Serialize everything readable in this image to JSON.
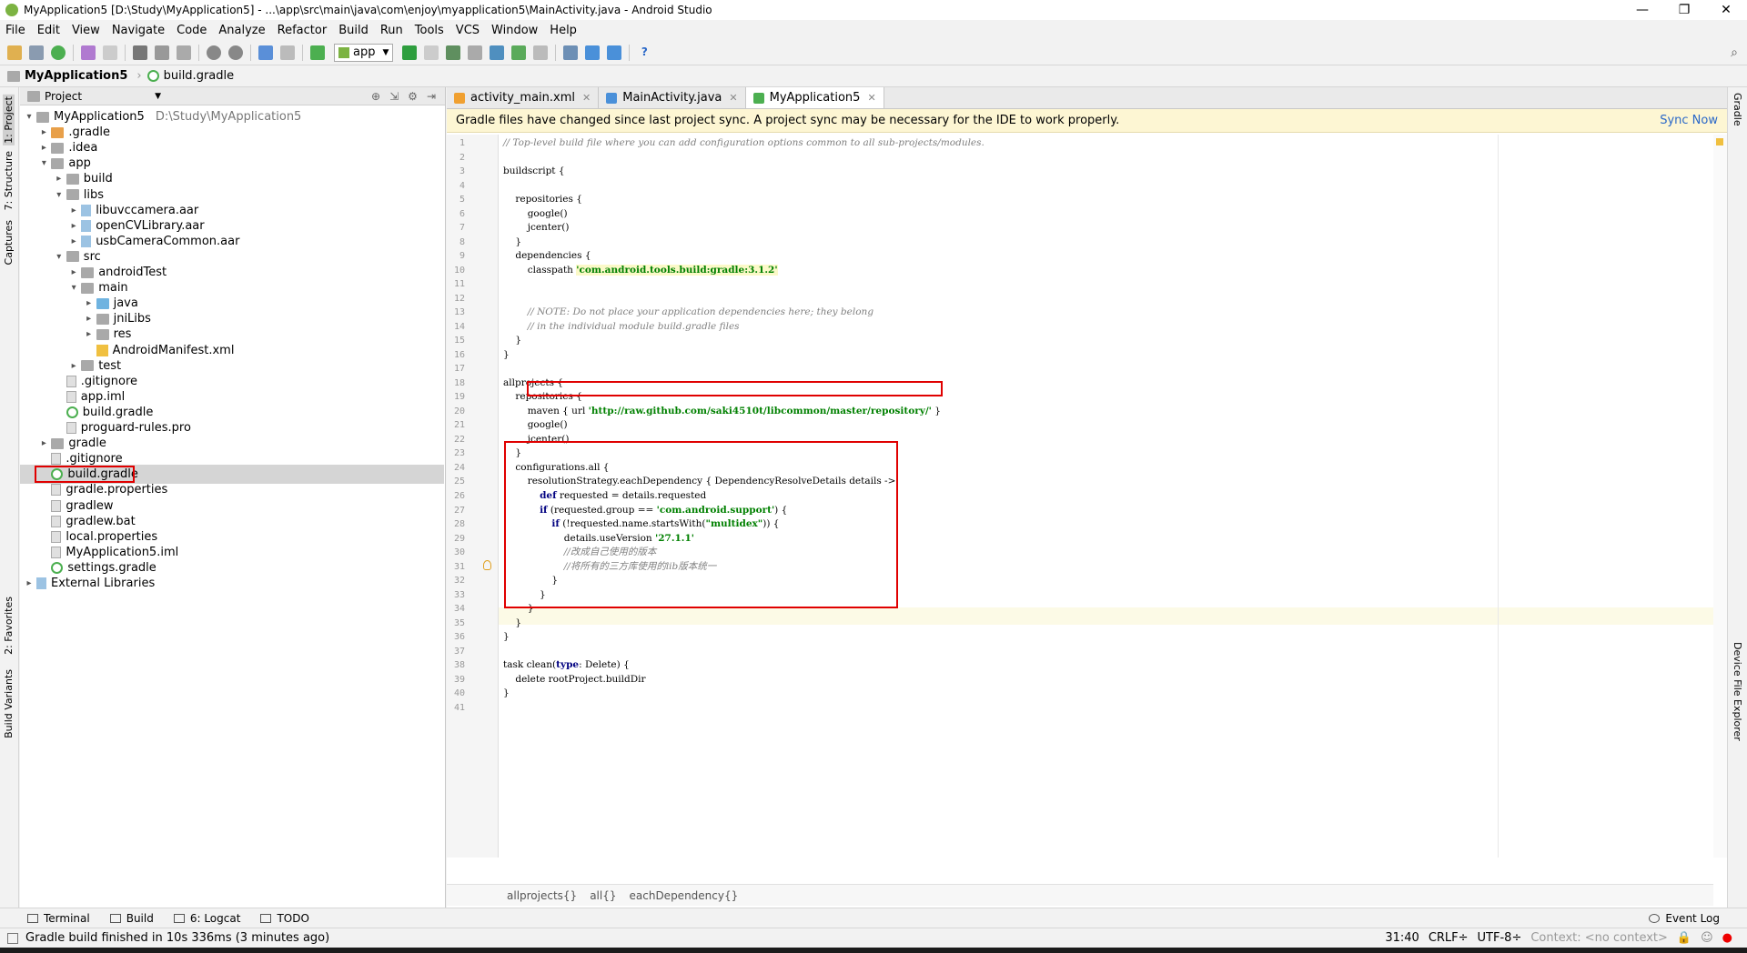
{
  "window": {
    "title": "MyApplication5 [D:\\Study\\MyApplication5] - ...\\app\\src\\main\\java\\com\\enjoy\\myapplication5\\MainActivity.java - Android Studio",
    "minimize": "—",
    "maximize": "❐",
    "close": "✕"
  },
  "menu": [
    "File",
    "Edit",
    "View",
    "Navigate",
    "Code",
    "Analyze",
    "Refactor",
    "Build",
    "Run",
    "Tools",
    "VCS",
    "Window",
    "Help"
  ],
  "toolbar": {
    "run_config": "app"
  },
  "navbar": {
    "project": "MyApplication5",
    "file": "build.gradle"
  },
  "left_strip": {
    "project": "1: Project",
    "structure": "7: Structure",
    "captures": "Captures",
    "favorites": "2: Favorites",
    "build_variants": "Build Variants"
  },
  "right_strip": {
    "gradle": "Gradle",
    "device_explorer": "Device File Explorer"
  },
  "project_panel": {
    "header": "Project",
    "tree": [
      {
        "label": "MyApplication5",
        "path": "D:\\Study\\MyApplication5",
        "depth": 0,
        "arrow": "▾",
        "icon": "folder"
      },
      {
        "label": ".gradle",
        "depth": 1,
        "arrow": "▸",
        "icon": "folder-orange"
      },
      {
        "label": ".idea",
        "depth": 1,
        "arrow": "▸",
        "icon": "folder"
      },
      {
        "label": "app",
        "depth": 1,
        "arrow": "▾",
        "icon": "folder"
      },
      {
        "label": "build",
        "depth": 2,
        "arrow": "▸",
        "icon": "folder"
      },
      {
        "label": "libs",
        "depth": 2,
        "arrow": "▾",
        "icon": "folder"
      },
      {
        "label": "libuvccamera.aar",
        "depth": 3,
        "arrow": "▸",
        "icon": "lib"
      },
      {
        "label": "openCVLibrary.aar",
        "depth": 3,
        "arrow": "▸",
        "icon": "lib"
      },
      {
        "label": "usbCameraCommon.aar",
        "depth": 3,
        "arrow": "▸",
        "icon": "lib"
      },
      {
        "label": "src",
        "depth": 2,
        "arrow": "▾",
        "icon": "folder"
      },
      {
        "label": "androidTest",
        "depth": 3,
        "arrow": "▸",
        "icon": "folder"
      },
      {
        "label": "main",
        "depth": 3,
        "arrow": "▾",
        "icon": "folder"
      },
      {
        "label": "java",
        "depth": 4,
        "arrow": "▸",
        "icon": "folder-blue"
      },
      {
        "label": "jniLibs",
        "depth": 4,
        "arrow": "▸",
        "icon": "folder"
      },
      {
        "label": "res",
        "depth": 4,
        "arrow": "▸",
        "icon": "folder"
      },
      {
        "label": "AndroidManifest.xml",
        "depth": 4,
        "arrow": "",
        "icon": "xml"
      },
      {
        "label": "test",
        "depth": 3,
        "arrow": "▸",
        "icon": "folder"
      },
      {
        "label": ".gitignore",
        "depth": 2,
        "arrow": "",
        "icon": "file"
      },
      {
        "label": "app.iml",
        "depth": 2,
        "arrow": "",
        "icon": "file"
      },
      {
        "label": "build.gradle",
        "depth": 2,
        "arrow": "",
        "icon": "gradle"
      },
      {
        "label": "proguard-rules.pro",
        "depth": 2,
        "arrow": "",
        "icon": "file"
      },
      {
        "label": "gradle",
        "depth": 1,
        "arrow": "▸",
        "icon": "folder"
      },
      {
        "label": ".gitignore",
        "depth": 1,
        "arrow": "",
        "icon": "file"
      },
      {
        "label": "build.gradle",
        "depth": 1,
        "arrow": "",
        "icon": "gradle",
        "selected": true
      },
      {
        "label": "gradle.properties",
        "depth": 1,
        "arrow": "",
        "icon": "file"
      },
      {
        "label": "gradlew",
        "depth": 1,
        "arrow": "",
        "icon": "file"
      },
      {
        "label": "gradlew.bat",
        "depth": 1,
        "arrow": "",
        "icon": "file"
      },
      {
        "label": "local.properties",
        "depth": 1,
        "arrow": "",
        "icon": "file"
      },
      {
        "label": "MyApplication5.iml",
        "depth": 1,
        "arrow": "",
        "icon": "file"
      },
      {
        "label": "settings.gradle",
        "depth": 1,
        "arrow": "",
        "icon": "gradle"
      },
      {
        "label": "External Libraries",
        "depth": 0,
        "arrow": "▸",
        "icon": "lib"
      }
    ]
  },
  "tabs": [
    {
      "label": "activity_main.xml",
      "color": "#f0a030",
      "active": false
    },
    {
      "label": "MainActivity.java",
      "color": "#4a90d9",
      "active": false
    },
    {
      "label": "MyApplication5",
      "color": "#4caf50",
      "active": true
    }
  ],
  "banner": {
    "message": "Gradle files have changed since last project sync. A project sync may be necessary for the IDE to work properly.",
    "action": "Sync Now"
  },
  "code_lines": [
    [
      {
        "t": "// Top-level build file where you can add configuration options common to all sub-projects/modules.",
        "c": "cm"
      }
    ],
    [],
    [
      {
        "t": "buildscript {"
      }
    ],
    [],
    [
      {
        "t": "    repositories {"
      }
    ],
    [
      {
        "t": "        google()"
      }
    ],
    [
      {
        "t": "        jcenter()"
      }
    ],
    [
      {
        "t": "    }"
      }
    ],
    [
      {
        "t": "    dependencies {"
      }
    ],
    [
      {
        "t": "        classpath "
      },
      {
        "t": "'com.android.tools.build:gradle:3.1.2'",
        "c": "st hl"
      }
    ],
    [],
    [],
    [
      {
        "t": "        // NOTE: Do not place your application dependencies here; they belong",
        "c": "cm"
      }
    ],
    [
      {
        "t": "        // in the individual module build.gradle files",
        "c": "cm"
      }
    ],
    [
      {
        "t": "    }"
      }
    ],
    [
      {
        "t": "}"
      }
    ],
    [],
    [
      {
        "t": "allprojects {"
      }
    ],
    [
      {
        "t": "    repositories {"
      }
    ],
    [
      {
        "t": "        maven { url "
      },
      {
        "t": "'http://raw.github.com/saki4510t/libcommon/master/repository/'",
        "c": "st"
      },
      {
        "t": " }"
      }
    ],
    [
      {
        "t": "        google()"
      }
    ],
    [
      {
        "t": "        jcenter()"
      }
    ],
    [
      {
        "t": "    }"
      }
    ],
    [
      {
        "t": "    configurations.all {"
      }
    ],
    [
      {
        "t": "        resolutionStrategy.eachDependency { DependencyResolveDetails details ->"
      }
    ],
    [
      {
        "t": "            "
      },
      {
        "t": "def",
        "c": "kw"
      },
      {
        "t": " requested = details.requested"
      }
    ],
    [
      {
        "t": "            "
      },
      {
        "t": "if",
        "c": "kw"
      },
      {
        "t": " (requested.group == "
      },
      {
        "t": "'com.android.support'",
        "c": "st"
      },
      {
        "t": ") {"
      }
    ],
    [
      {
        "t": "                "
      },
      {
        "t": "if",
        "c": "kw"
      },
      {
        "t": " (!requested.name.startsWith("
      },
      {
        "t": "\"multidex\"",
        "c": "st"
      },
      {
        "t": ")) {"
      }
    ],
    [
      {
        "t": "                    details.useVersion "
      },
      {
        "t": "'27.1.1'",
        "c": "st"
      }
    ],
    [
      {
        "t": "                    //改成自己使用的版本",
        "c": "cm"
      }
    ],
    [
      {
        "t": "                    //将所有的三方库使用的lib版本统一",
        "c": "cm"
      }
    ],
    [
      {
        "t": "                }"
      }
    ],
    [
      {
        "t": "            }"
      }
    ],
    [
      {
        "t": "        }"
      }
    ],
    [
      {
        "t": "    }"
      }
    ],
    [
      {
        "t": "}"
      }
    ],
    [],
    [
      {
        "t": "task clean("
      },
      {
        "t": "type",
        "c": "kw"
      },
      {
        "t": ": Delete) {"
      }
    ],
    [
      {
        "t": "    delete rootProject.buildDir"
      }
    ],
    [
      {
        "t": "}"
      }
    ],
    []
  ],
  "breadcrumb": [
    "allprojects{}",
    "all{}",
    "eachDependency{}"
  ],
  "bottom_tools": {
    "terminal": "Terminal",
    "build": "Build",
    "logcat": "6: Logcat",
    "todo": "TODO",
    "event_log": "Event Log"
  },
  "status": {
    "message": "Gradle build finished in 10s 336ms (3 minutes ago)",
    "position": "31:40",
    "line_sep": "CRLF÷",
    "encoding": "UTF-8÷",
    "context": "Context: <no context>"
  }
}
